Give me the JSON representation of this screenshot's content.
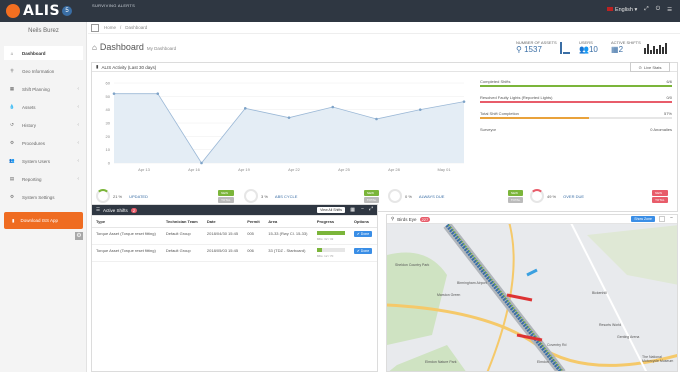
{
  "app": {
    "name": "ALIS",
    "badge": "5",
    "alert": "SURVIVING ALERTS",
    "language": "English",
    "user": "Neils Burez"
  },
  "sidebar": {
    "items": [
      {
        "label": "Dashboard",
        "icon": "home-icon",
        "active": true
      },
      {
        "label": "Geo Information",
        "icon": "map-pin-icon"
      },
      {
        "label": "Shift Planning",
        "icon": "calendar-icon"
      },
      {
        "label": "Assets",
        "icon": "droplet-icon"
      },
      {
        "label": "History",
        "icon": "history-icon"
      },
      {
        "label": "Procedures",
        "icon": "settings-icon"
      },
      {
        "label": "System Users",
        "icon": "users-icon"
      },
      {
        "label": "Reporting",
        "icon": "document-icon"
      },
      {
        "label": "System Settings",
        "icon": "gears-icon"
      }
    ],
    "download_label": "Download ISS App"
  },
  "breadcrumb": {
    "home": "Home",
    "sep": "/",
    "current": "Dashboard"
  },
  "page": {
    "title": "Dashboard",
    "subtitle": "My Dashboard"
  },
  "stats": [
    {
      "label": "NUMBER OF ASSETS",
      "value": "1537"
    },
    {
      "label": "USERS",
      "value": "10"
    },
    {
      "label": "ACTIVE SHIFTS",
      "value": "2"
    }
  ],
  "activity": {
    "title": "ALIS Activity (Last 30 days)",
    "live_label": "Live Stats"
  },
  "chart_data": {
    "type": "area",
    "x": [
      "Apr 13",
      "Apr 16",
      "Apr 19",
      "Apr 22",
      "Apr 25",
      "Apr 28",
      "May 01"
    ],
    "y_ticks": [
      "0",
      "10",
      "20",
      "30",
      "40",
      "50",
      "60"
    ],
    "ylim": [
      0,
      60
    ],
    "values": [
      52,
      52,
      0,
      41,
      34,
      42,
      33,
      40,
      46
    ],
    "grid": true
  },
  "kpis": [
    {
      "label": "Completed Shifts",
      "value": "6/6",
      "fill": 1.0
    },
    {
      "label": "Resolved Faulty Lights (Reported Lights)",
      "value": "0/0",
      "fill": 0.0
    },
    {
      "label": "Total Shift Completion",
      "value": "57%",
      "fill": 0.57
    },
    {
      "label": "Surveyor",
      "value": "0 Anomalies",
      "fill": 0.0
    }
  ],
  "gauges": [
    {
      "percent": "21 %",
      "label": "UPDATED",
      "tags": [
        "NEW",
        "TOTAL"
      ]
    },
    {
      "percent": "3 %",
      "label": "ABS CYCLE",
      "tags": [
        "NEW",
        "TOTAL"
      ]
    },
    {
      "percent": "0 %",
      "label": "ALWAYS DUE",
      "tags": [
        "NEW",
        "TOTAL"
      ]
    },
    {
      "percent": "49 %",
      "label": "OVER DUE",
      "tags": [
        "NEW",
        "TOTAL"
      ]
    }
  ],
  "shifts": {
    "title": "Active Shifts",
    "count": "2",
    "view_all": "View All Shifts",
    "columns": [
      "Type",
      "Technician Team",
      "Date",
      "Permit",
      "Area",
      "Progress",
      "Options"
    ],
    "rows": [
      {
        "type": "Torque Asset (Torque reset fitting)",
        "team": "Default Group",
        "date": "2018/04/30 15:45",
        "permit": "005",
        "area": "15-33 (Rwy Cl. 15-33)",
        "progress": 1.0,
        "progress_text": "Mfts: 32 / 32",
        "option": "Done"
      },
      {
        "type": "Torque Asset (Torque reset fitting)",
        "team": "Default Group",
        "date": "2018/05/03 15:45",
        "permit": "006",
        "area": "33 (TDZ - Starboard)",
        "progress": 0.17,
        "progress_text": "Mfts: 12 / 70",
        "option": "Done"
      }
    ]
  },
  "map": {
    "title": "Birds Eye",
    "badge": "227",
    "show_button": "Show Zone",
    "labels": [
      "Sheldon Country Park",
      "Birmingham Airport",
      "Marston Green",
      "Elmdon",
      "Elmdon Nature Park",
      "Bickenhill",
      "Resorts World",
      "Genting Arena",
      "The National Motorcycle Museum",
      "Coventry Rd"
    ]
  },
  "colors": {
    "accent": "#3a6ea5",
    "orange": "#ef6c21",
    "green": "#7bb53a",
    "red": "#e85c6a",
    "topbar": "#2f3742"
  }
}
